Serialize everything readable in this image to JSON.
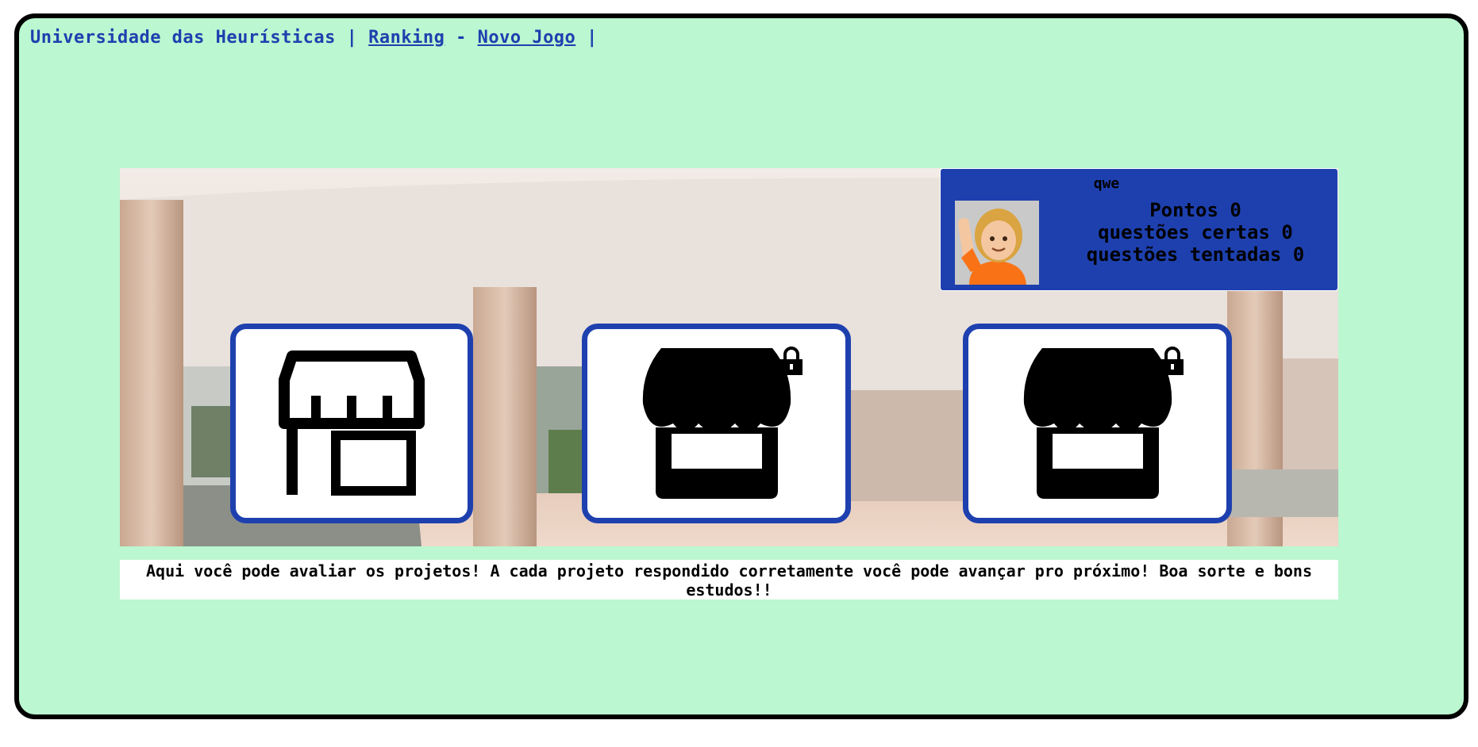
{
  "nav": {
    "site_title": "Universidade das Heurísticas",
    "sep1": "|",
    "ranking_link": "Ranking",
    "sep2": "-",
    "new_game_link": "Novo Jogo",
    "sep3": "|"
  },
  "player": {
    "name": "qwe",
    "avatar_icon": "person-raising-hand-emoji",
    "points_label": "Pontos 0",
    "correct_label": "questões certas 0",
    "attempted_label": "questões tentadas 0"
  },
  "projects": [
    {
      "icon": "store-outline-icon",
      "locked": false
    },
    {
      "icon": "store-filled-icon",
      "locked": true,
      "lock_icon": "lock-icon"
    },
    {
      "icon": "store-filled-icon",
      "locked": true,
      "lock_icon": "lock-icon"
    }
  ],
  "instructions": "Aqui você pode avaliar os projetos! A cada projeto respondido corretamente você pode avançar pro próximo! Boa sorte e bons estudos!!",
  "colors": {
    "page_background": "#bbf7d0",
    "accent_blue": "#1e40af",
    "frame_border": "#000000"
  }
}
